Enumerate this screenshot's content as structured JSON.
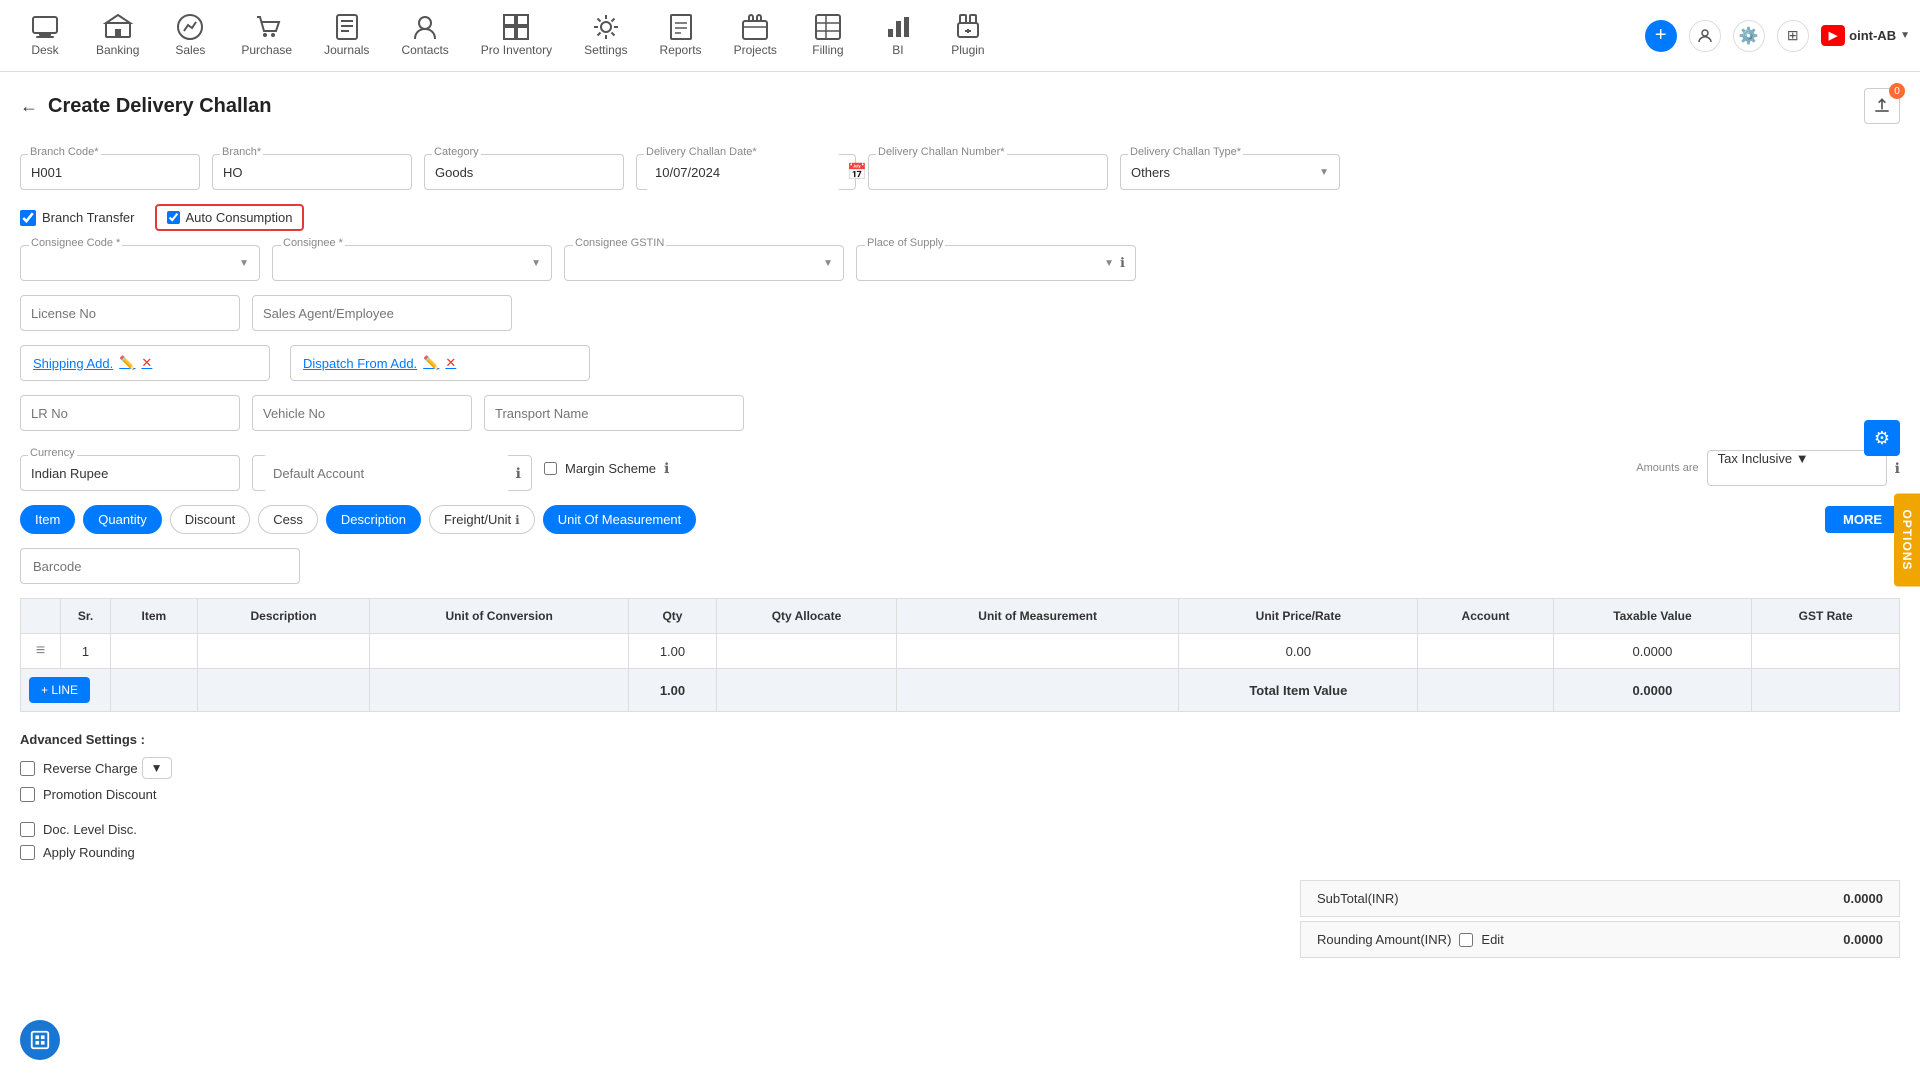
{
  "nav": {
    "items": [
      {
        "label": "Desk",
        "icon": "🏠"
      },
      {
        "label": "Banking",
        "icon": "🏦"
      },
      {
        "label": "Sales",
        "icon": "📊"
      },
      {
        "label": "Purchase",
        "icon": "🛒"
      },
      {
        "label": "Journals",
        "icon": "📋"
      },
      {
        "label": "Contacts",
        "icon": "👥"
      },
      {
        "label": "Pro Inventory",
        "icon": "📦"
      },
      {
        "label": "Settings",
        "icon": "⚙️"
      },
      {
        "label": "Reports",
        "icon": "📈"
      },
      {
        "label": "Projects",
        "icon": "📁"
      },
      {
        "label": "Filling",
        "icon": "🗂️"
      },
      {
        "label": "BI",
        "icon": "📉"
      },
      {
        "label": "Plugin",
        "icon": "🔌"
      }
    ],
    "brand": "oint-AB",
    "brand_prefix": "▶"
  },
  "page": {
    "title": "Create Delivery Challan",
    "back_label": "←",
    "badge_count": "0"
  },
  "form": {
    "branch_code_label": "Branch Code*",
    "branch_code_value": "H001",
    "branch_label": "Branch*",
    "branch_value": "HO",
    "category_label": "Category",
    "category_value": "Goods",
    "delivery_challan_date_label": "Delivery Challan Date*",
    "delivery_challan_date_value": "10/07/2024",
    "delivery_challan_number_label": "Delivery Challan Number*",
    "delivery_challan_number_value": "",
    "delivery_challan_type_label": "Delivery Challan Type*",
    "delivery_challan_type_value": "Others",
    "branch_transfer_label": "Branch Transfer",
    "branch_transfer_checked": true,
    "auto_consumption_label": "Auto Consumption",
    "auto_consumption_checked": true,
    "consignee_code_label": "Consignee Code *",
    "consignee_label": "Consignee *",
    "consignee_gstin_label": "Consignee GSTIN",
    "place_of_supply_label": "Place of Supply",
    "license_no_label": "License No",
    "license_no_value": "",
    "sales_agent_label": "Sales Agent/Employee",
    "sales_agent_value": "",
    "shipping_add_label": "Shipping Add.",
    "dispatch_from_add_label": "Dispatch From Add.",
    "lr_no_label": "LR No",
    "lr_no_value": "",
    "vehicle_no_label": "Vehicle No",
    "vehicle_no_value": "",
    "transport_name_label": "Transport Name",
    "transport_name_value": "",
    "currency_label": "Currency",
    "currency_value": "Indian Rupee",
    "default_account_label": "Default Account",
    "default_account_value": "",
    "margin_scheme_label": "Margin Scheme",
    "amounts_are_label": "Amounts are",
    "amounts_are_value": "Tax Inclusive"
  },
  "tags": {
    "items": [
      {
        "label": "Item",
        "active": true
      },
      {
        "label": "Quantity",
        "active": true
      },
      {
        "label": "Discount",
        "active": false
      },
      {
        "label": "Cess",
        "active": false
      },
      {
        "label": "Description",
        "active": true
      },
      {
        "label": "Freight/Unit",
        "active": false
      },
      {
        "label": "Unit Of Measurement",
        "active": true
      }
    ],
    "more_label": "MORE"
  },
  "barcode": {
    "placeholder": "Barcode"
  },
  "table": {
    "columns": [
      "",
      "Sr.",
      "Item",
      "Description",
      "Unit of Conversion",
      "Qty",
      "Qty Allocate",
      "Unit of Measurement",
      "Unit Price/Rate",
      "Account",
      "Taxable Value",
      "GST Rate"
    ],
    "rows": [
      {
        "sr": "1",
        "item": "",
        "description": "",
        "unit_conv": "",
        "qty": "1.00",
        "qty_allocate": "",
        "uom": "",
        "unit_price": "0.00",
        "account": "",
        "taxable_value": "0.0000",
        "gst_rate": ""
      }
    ],
    "total_row": {
      "qty": "1.00",
      "total_item_value_label": "Total Item Value",
      "total_value": "0.0000"
    },
    "add_line_label": "+ LINE"
  },
  "advanced_settings": {
    "title": "Advanced Settings :",
    "reverse_charge_label": "Reverse Charge",
    "reverse_charge_checked": false,
    "promotion_discount_label": "Promotion Discount",
    "promotion_discount_checked": false,
    "doc_level_disc_label": "Doc. Level Disc.",
    "doc_level_disc_checked": false,
    "apply_rounding_label": "Apply Rounding",
    "apply_rounding_checked": false
  },
  "totals": {
    "subtotal_label": "SubTotal(INR)",
    "subtotal_value": "0.0000",
    "rounding_label": "Rounding Amount(INR)",
    "rounding_value": "0.0000",
    "edit_label": "Edit"
  },
  "options_sidebar": {
    "label": "OPTIONS"
  }
}
